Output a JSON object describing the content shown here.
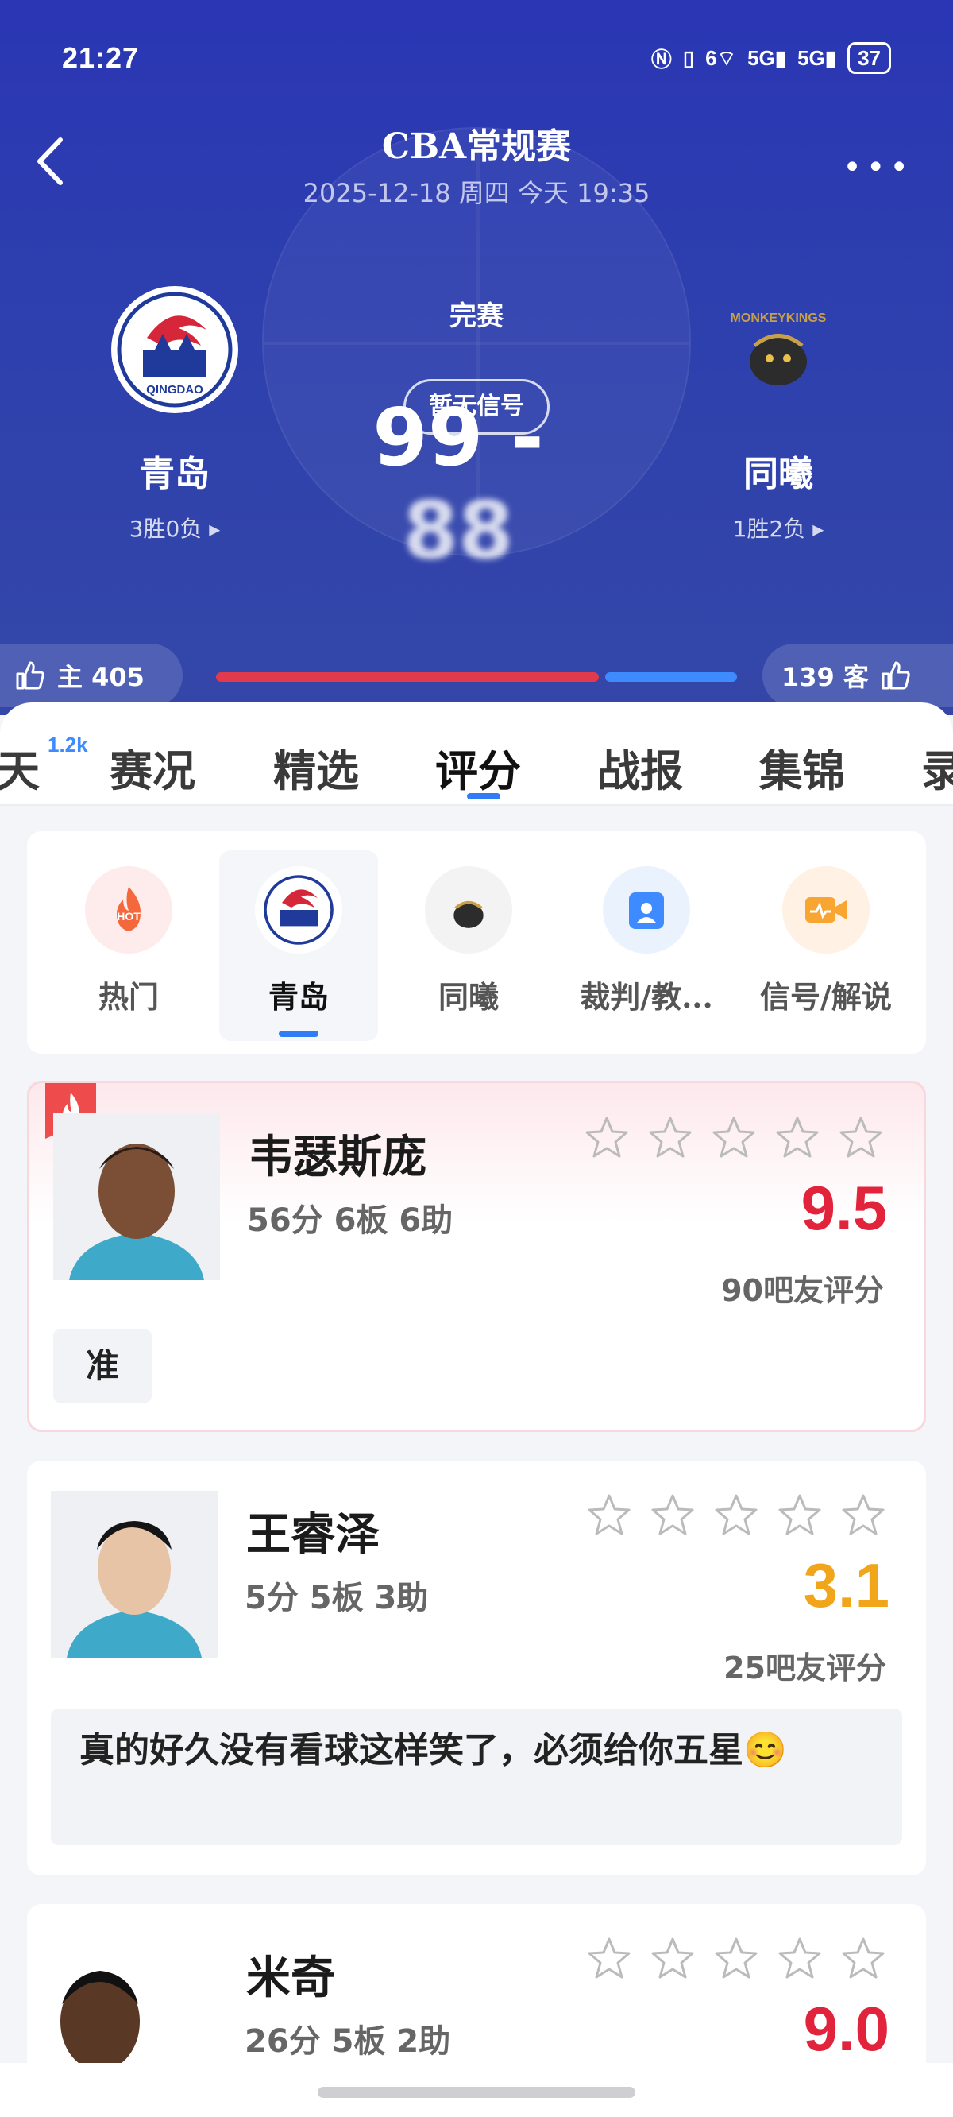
{
  "status": {
    "time": "21:27",
    "net1": "6",
    "net2": "5G",
    "net3": "5G",
    "battery": "37"
  },
  "header": {
    "title": "CBA常规赛",
    "subtitle": "2025-12-18 周四 今天 19:35",
    "state": "完赛",
    "score_home": "99",
    "score_sep": "-",
    "score_away": "88",
    "signal": "暂无信号",
    "home": {
      "name": "青岛",
      "record": "3胜0负 ▸",
      "logo_text": "QINGDAO"
    },
    "away": {
      "name": "同曦",
      "record": "1胜2负 ▸",
      "logo_text": "MONKEYKINGS"
    },
    "likes_home": "主 405",
    "likes_away": "139 客",
    "home_like_share": 0.744
  },
  "tabs": {
    "badge": "1.2k",
    "items": [
      "天",
      "赛况",
      "精选",
      "评分",
      "战报",
      "集锦",
      "录"
    ],
    "active": "评分"
  },
  "filters": [
    "热门",
    "青岛",
    "同曦",
    "裁判/教...",
    "信号/解说"
  ],
  "filter_hot_text": "HOT",
  "players": [
    {
      "name": "韦瑟斯庞",
      "stats": "56分 6板 6助",
      "score": "9.5",
      "rating_count": "90吧友评分",
      "tag": "准"
    },
    {
      "name": "王睿泽",
      "stats": "5分 5板 3助",
      "score": "3.1",
      "rating_count": "25吧友评分",
      "comment": "真的好久没有看球这样笑了，必须给你五星😊"
    },
    {
      "name": "米奇",
      "stats": "26分 5板 2助",
      "score": "9.0"
    }
  ],
  "colors": {
    "accent": "#2f7cf6",
    "score_high": "#e2233c",
    "score_low": "#f1a51a",
    "header_bg": "#2d3fae"
  }
}
